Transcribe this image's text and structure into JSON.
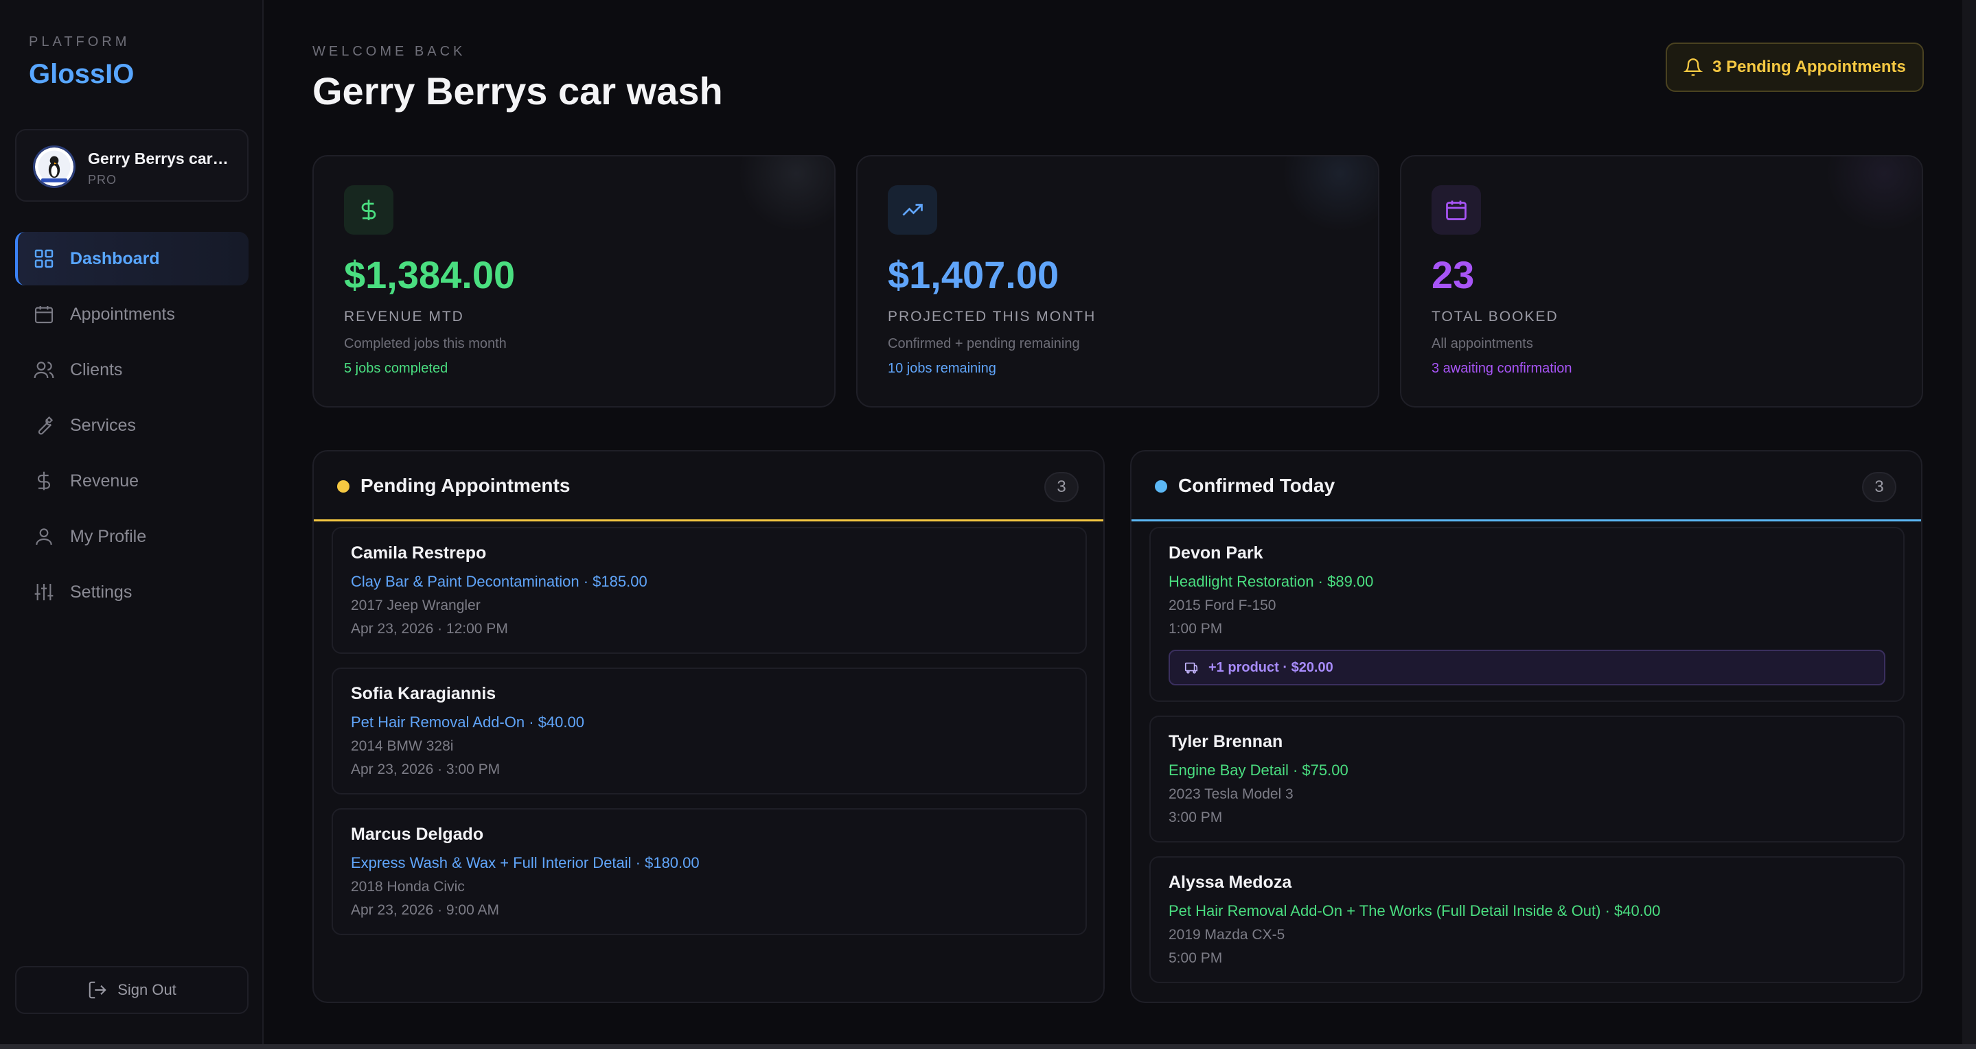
{
  "sidebar": {
    "kicker": "PLATFORM",
    "brand": "GlossIO",
    "account": {
      "name": "Gerry Berrys car wash",
      "plan": "PRO"
    },
    "items": [
      {
        "label": "Dashboard",
        "icon": "grid-icon",
        "active": true
      },
      {
        "label": "Appointments",
        "icon": "calendar-icon"
      },
      {
        "label": "Clients",
        "icon": "users-icon"
      },
      {
        "label": "Services",
        "icon": "wrench-icon"
      },
      {
        "label": "Revenue",
        "icon": "dollar-icon"
      },
      {
        "label": "My Profile",
        "icon": "user-icon"
      },
      {
        "label": "Settings",
        "icon": "sliders-icon"
      }
    ],
    "signout": "Sign Out"
  },
  "header": {
    "kicker": "WELCOME BACK",
    "title": "Gerry Berrys car wash",
    "pending_button": "3 Pending Appointments"
  },
  "stats": [
    {
      "value": "$1,384.00",
      "label": "REVENUE MTD",
      "desc": "Completed jobs this month",
      "note": "5 jobs completed",
      "color": "#4ade80",
      "icon": "dollar-icon"
    },
    {
      "value": "$1,407.00",
      "label": "PROJECTED THIS MONTH",
      "desc": "Confirmed + pending remaining",
      "note": "10 jobs remaining",
      "color": "#60a5fa",
      "icon": "trending-up-icon"
    },
    {
      "value": "23",
      "label": "TOTAL BOOKED",
      "desc": "All appointments",
      "note": "3 awaiting confirmation",
      "color": "#a855f7",
      "icon": "calendar-icon"
    }
  ],
  "pending": {
    "title": "Pending Appointments",
    "count": "3",
    "color": "#f5c842",
    "items": [
      {
        "name": "Camila Restrepo",
        "service": "Clay Bar & Paint Decontamination · $185.00",
        "vehicle": "2017 Jeep Wrangler",
        "time": "Apr 23, 2026 · 12:00 PM"
      },
      {
        "name": "Sofia Karagiannis",
        "service": "Pet Hair Removal Add-On · $40.00",
        "vehicle": "2014 BMW 328i",
        "time": "Apr 23, 2026 · 3:00 PM"
      },
      {
        "name": "Marcus Delgado",
        "service": "Express Wash & Wax + Full Interior Detail · $180.00",
        "vehicle": "2018 Honda Civic",
        "time": "Apr 23, 2026 · 9:00 AM"
      }
    ]
  },
  "confirmed": {
    "title": "Confirmed Today",
    "count": "3",
    "color": "#5cb8f5",
    "items": [
      {
        "name": "Devon Park",
        "service": "Headlight Restoration · $89.00",
        "vehicle": "2015 Ford F-150",
        "time": "1:00 PM",
        "extra": "+1 product · $20.00"
      },
      {
        "name": "Tyler Brennan",
        "service": "Engine Bay Detail · $75.00",
        "vehicle": "2023 Tesla Model 3",
        "time": "3:00 PM"
      },
      {
        "name": "Alyssa Medoza",
        "service": "Pet Hair Removal Add-On + The Works (Full Detail Inside & Out) · $40.00",
        "vehicle": "2019 Mazda CX-5",
        "time": "5:00 PM"
      }
    ]
  }
}
